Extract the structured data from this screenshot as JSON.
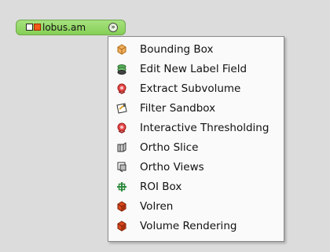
{
  "node": {
    "label": "lobus.am",
    "menu_button": "»"
  },
  "menu": {
    "items": [
      {
        "label": "Bounding Box",
        "icon": "bounding-box-icon"
      },
      {
        "label": "Edit New Label Field",
        "icon": "label-field-icon"
      },
      {
        "label": "Extract Subvolume",
        "icon": "extract-subvolume-icon"
      },
      {
        "label": "Filter Sandbox",
        "icon": "filter-sandbox-icon"
      },
      {
        "label": "Interactive Thresholding",
        "icon": "threshold-icon"
      },
      {
        "label": "Ortho Slice",
        "icon": "ortho-slice-icon"
      },
      {
        "label": "Ortho Views",
        "icon": "ortho-views-icon"
      },
      {
        "label": "ROI Box",
        "icon": "roi-box-icon"
      },
      {
        "label": "Volren",
        "icon": "volren-icon"
      },
      {
        "label": "Volume Rendering",
        "icon": "volume-rendering-icon"
      }
    ]
  },
  "colors": {
    "node_green": "#8fd662",
    "port_orange": "#f25a1a",
    "background": "#dcdcdc"
  }
}
